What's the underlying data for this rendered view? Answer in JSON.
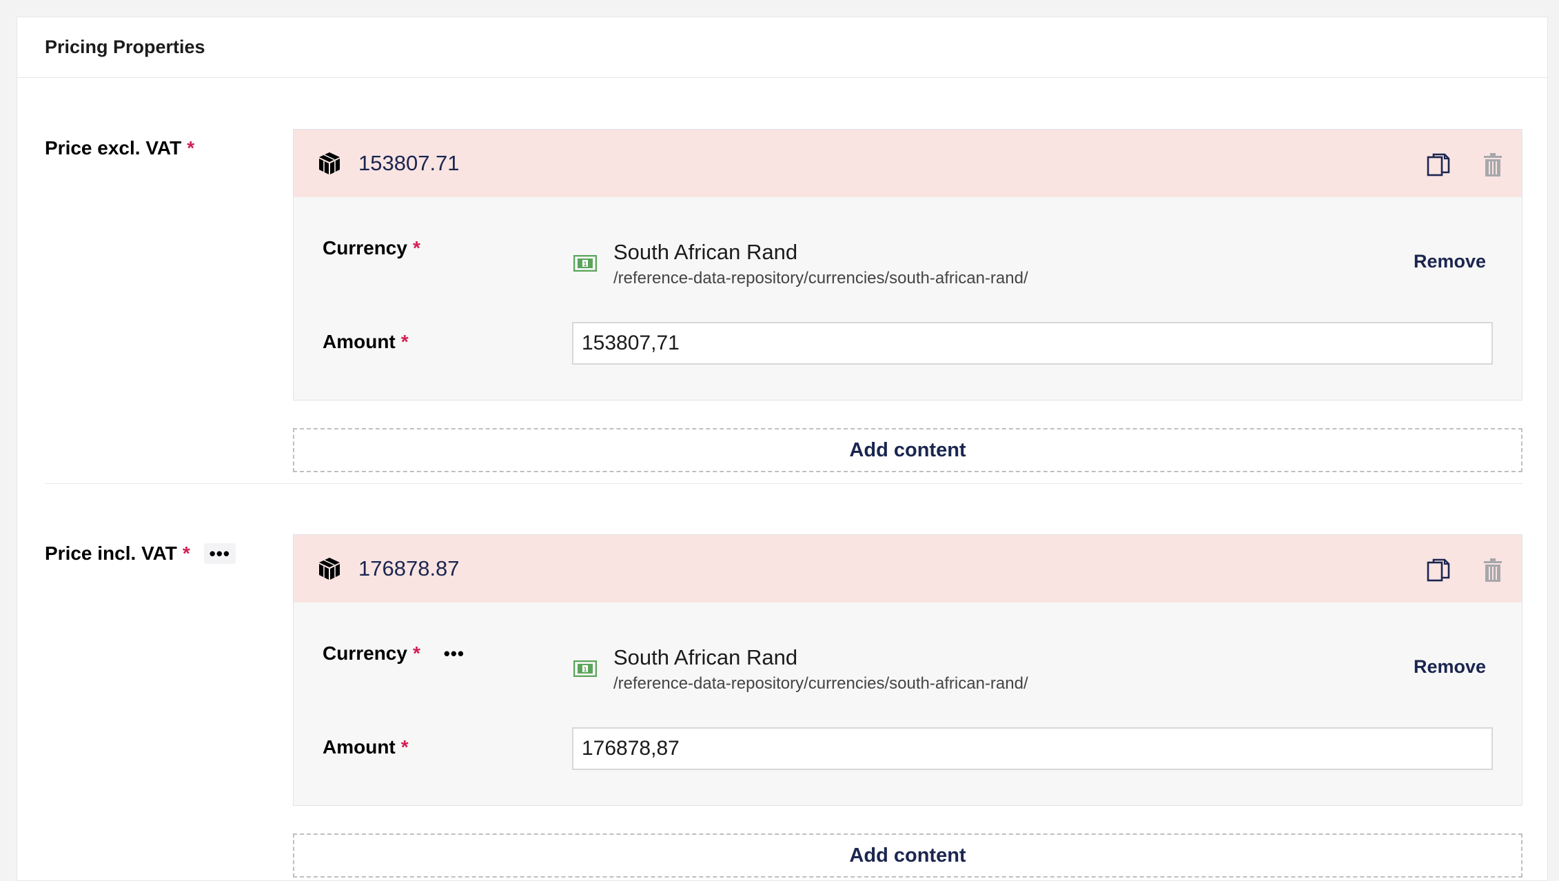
{
  "panel": {
    "title": "Pricing Properties"
  },
  "properties": [
    {
      "label": "Price excl. VAT",
      "required_mark": "*",
      "has_actions_menu": false,
      "block": {
        "name": "153807.71",
        "currency_label": "Currency",
        "currency_value": "South African Rand",
        "currency_path": "/reference-data-repository/currencies/south-african-rand/",
        "remove_label": "Remove",
        "amount_label": "Amount",
        "amount_value": "153807,71"
      },
      "add_content_label": "Add content"
    },
    {
      "label": "Price incl. VAT",
      "required_mark": "*",
      "has_actions_menu": true,
      "actions_label": "•••",
      "block": {
        "name": "176878.87",
        "currency_label": "Currency",
        "currency_actions_label": "•••",
        "currency_value": "South African Rand",
        "currency_path": "/reference-data-repository/currencies/south-african-rand/",
        "remove_label": "Remove",
        "amount_label": "Amount",
        "amount_value": "176878,87"
      },
      "add_content_label": "Add content"
    }
  ],
  "colors": {
    "accent_text": "#1b264f",
    "required": "#d42054",
    "block_header_bg": "#f9e4e2",
    "currency_icon": "#5aa55a"
  },
  "icons": [
    "cube-icon",
    "copy-icon",
    "trash-icon",
    "currency-icon",
    "more-icon"
  ]
}
